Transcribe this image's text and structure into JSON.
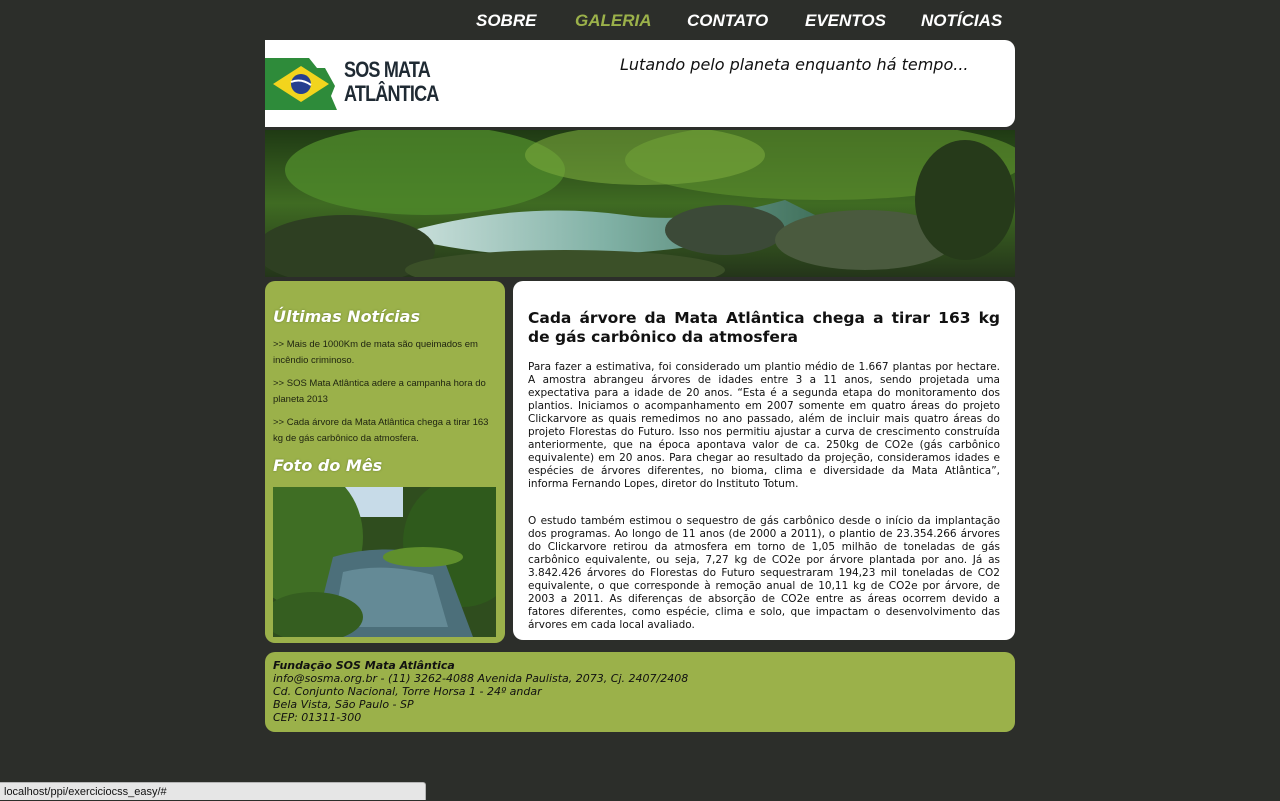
{
  "nav": {
    "items": [
      "SOBRE",
      "GALERIA",
      "CONTATO",
      "EVENTOS",
      "NOTÍCIAS"
    ],
    "active": "GALERIA"
  },
  "header": {
    "logo_line1": "SOS MATA",
    "logo_line2": "ATLÂNTICA",
    "tagline": "Lutando pelo planeta enquanto há tempo..."
  },
  "sidebar": {
    "news_title": "Últimas Notícias",
    "news": [
      ">> Mais de 1000Km de mata são queimados em incêndio criminoso.",
      ">> SOS Mata Atlântica adere a campanha hora do planeta 2013",
      ">> Cada árvore da Mata Atlântica chega a tirar 163 kg de gás carbônico da atmosfera."
    ],
    "photo_title": "Foto do Mês"
  },
  "article": {
    "title": "Cada árvore da Mata Atlântica chega a tirar 163 kg de gás carbônico da atmosfera",
    "paragraphs": [
      "Para fazer a estimativa, foi considerado um plantio médio de 1.667 plantas por hectare. A amostra abrangeu árvores de idades entre 3 a 11 anos, sendo projetada uma expectativa para a idade de 20 anos. “Esta é a segunda etapa do monitoramento dos plantios. Iniciamos o acompanhamento em 2007 somente em quatro áreas do projeto Clickarvore as quais remedimos no ano passado, além de incluir mais quatro áreas do projeto Florestas do Futuro. Isso nos permitiu ajustar a curva de crescimento construída anteriormente, que na época apontava valor de ca. 250kg de CO2e (gás carbônico equivalente) em 20 anos. Para chegar ao resultado da projeção, consideramos idades e espécies de árvores diferentes, no bioma, clima e diversidade da Mata Atlântica”, informa Fernando Lopes, diretor do Instituto Totum.",
      "O estudo também estimou o sequestro de gás carbônico desde o início da implantação dos programas. Ao longo de 11 anos (de 2000 a 2011), o plantio de 23.354.266 árvores do Clickarvore retirou da atmosfera em torno de 1,05 milhão de toneladas de gás carbônico equivalente, ou seja, 7,27 kg de CO2e por árvore plantada por ano. Já as 3.842.426 árvores do Florestas do Futuro sequestraram 194,23 mil toneladas de CO2 equivalente, o que corresponde à remoção anual de 10,11 kg de CO2e por árvore, de 2003 a 2011. As diferenças de absorção de CO2e entre as áreas ocorrem devido a fatores diferentes, como espécie, clima e solo, que impactam o desenvolvimento das árvores em cada local avaliado."
    ]
  },
  "footer": {
    "org": "Fundação SOS Mata Atlântica",
    "lines": [
      "info@sosma.org.br - (11) 3262-4088 Avenida Paulista, 2073, Cj. 2407/2408",
      "Cd. Conjunto Nacional, Torre Horsa 1 - 24º andar",
      "Bela Vista, São Paulo - SP",
      "CEP: 01311-300"
    ]
  },
  "statusbar": {
    "url": "localhost/ppi/exerciciocss_easy/#"
  },
  "colors": {
    "background": "#2c2e2a",
    "accent_green": "#9bb14a",
    "card": "#ffffff"
  }
}
